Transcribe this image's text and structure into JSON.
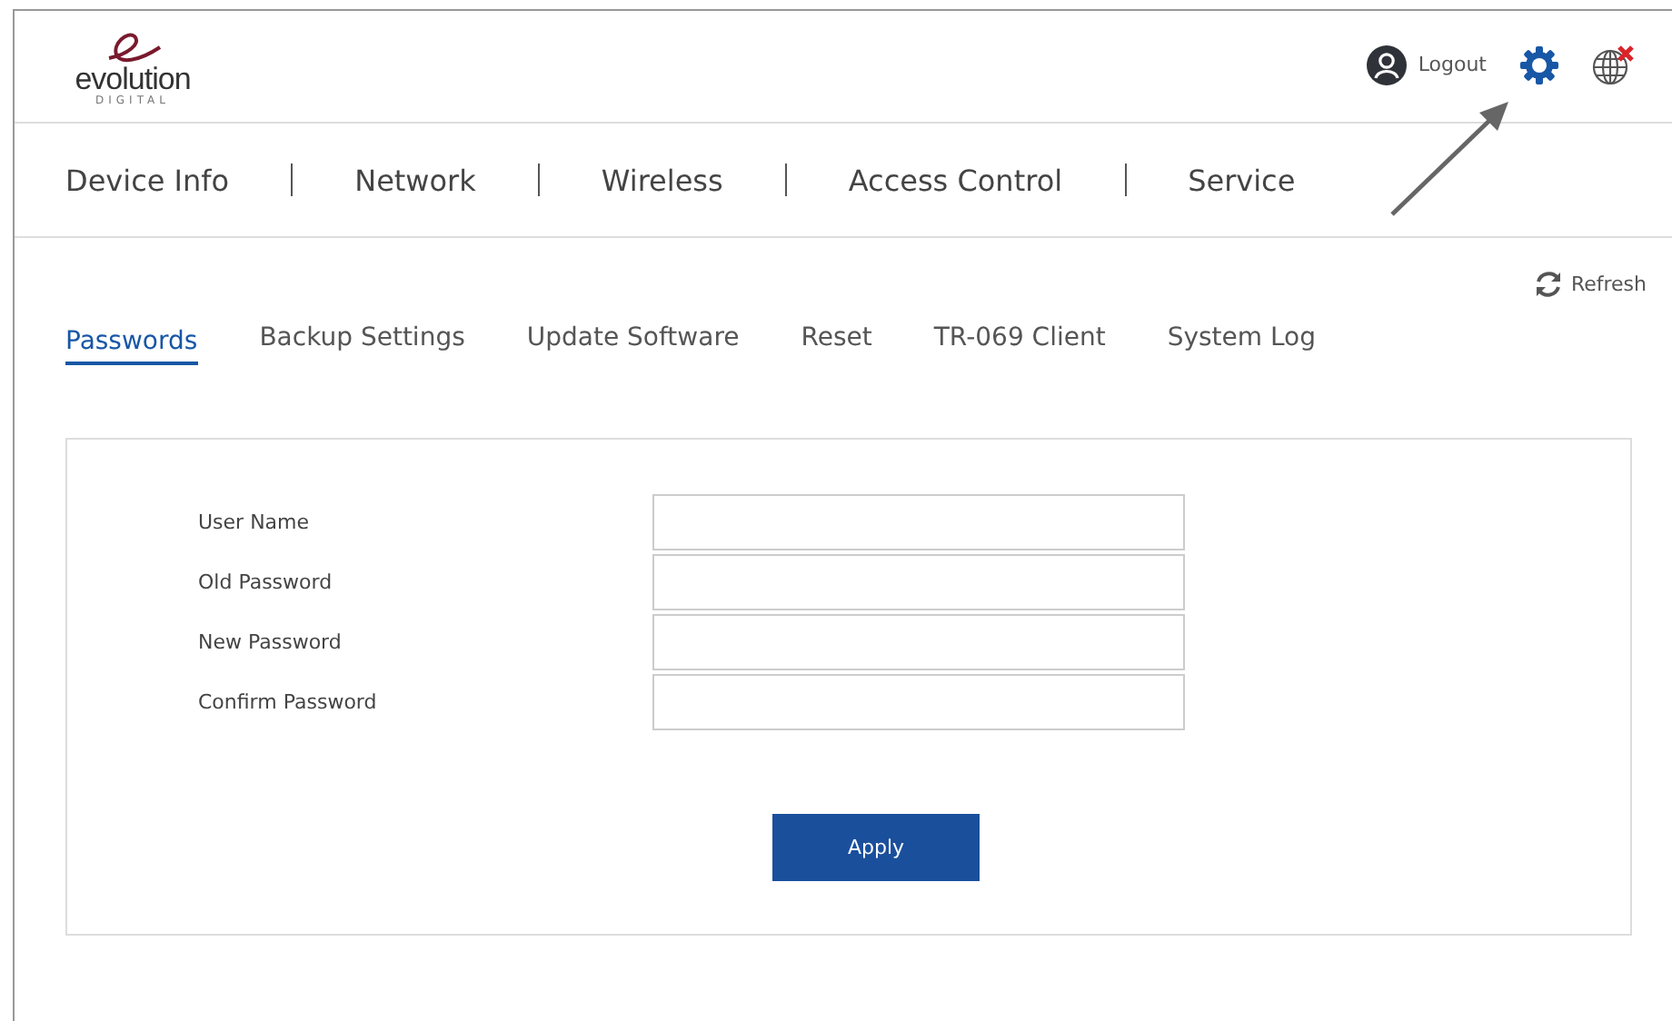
{
  "logo": {
    "name": "evolution",
    "tagline": "DIGITAL"
  },
  "header": {
    "logout": "Logout"
  },
  "nav": [
    {
      "label": "Device Info",
      "selected": false
    },
    {
      "label": "Network",
      "selected": false
    },
    {
      "label": "Wireless",
      "selected": false
    },
    {
      "label": "Access Control",
      "selected": false
    },
    {
      "label": "Service",
      "selected": false
    }
  ],
  "refresh": "Refresh",
  "subtabs": [
    {
      "label": "Passwords",
      "selected": true
    },
    {
      "label": "Backup Settings",
      "selected": false
    },
    {
      "label": "Update Software",
      "selected": false
    },
    {
      "label": "Reset",
      "selected": false
    },
    {
      "label": "TR-069 Client",
      "selected": false
    },
    {
      "label": "System Log",
      "selected": false
    }
  ],
  "form": {
    "fields": [
      {
        "label": "User Name"
      },
      {
        "label": "Old Password"
      },
      {
        "label": "New Password"
      },
      {
        "label": "Confirm Password"
      }
    ],
    "button": "Apply"
  }
}
